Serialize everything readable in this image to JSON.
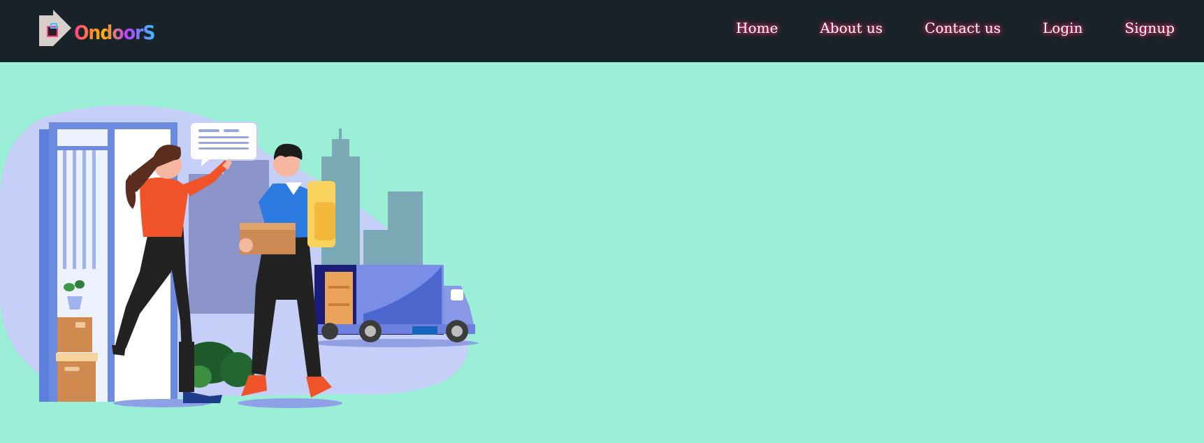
{
  "header": {
    "logo_text": "OndoorS",
    "nav": [
      {
        "label": "Home"
      },
      {
        "label": "About us"
      },
      {
        "label": "Contact us"
      },
      {
        "label": "Login"
      },
      {
        "label": "Signup"
      }
    ]
  },
  "colors": {
    "header_bg": "#172328",
    "page_bg": "#9befd7",
    "nav_glow": "#ff2a68"
  },
  "hero": {
    "illustration": "delivery-illustration"
  }
}
